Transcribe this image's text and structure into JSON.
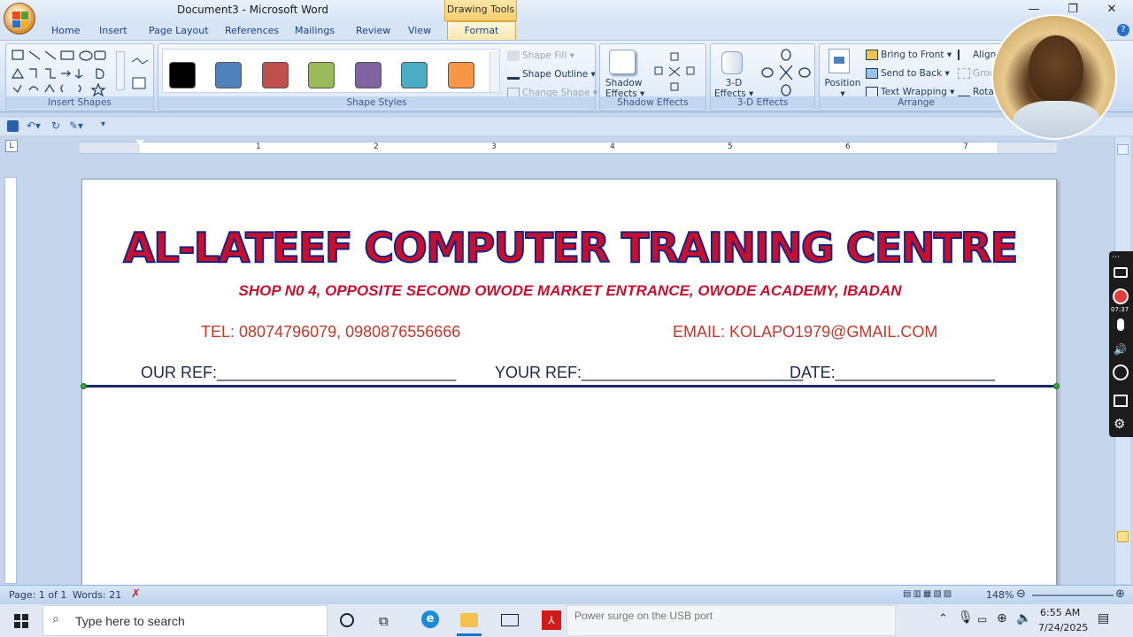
{
  "window": {
    "title": "Document3 - Microsoft Word",
    "contextual_tab_group": "Drawing Tools",
    "controls": {
      "minimize": "—",
      "restore": "❐",
      "close": "✕"
    }
  },
  "ribbon_tabs": [
    "Home",
    "Insert",
    "Page Layout",
    "References",
    "Mailings",
    "Review",
    "View"
  ],
  "active_tab": "Format",
  "groups": {
    "insert_shapes": "Insert Shapes",
    "shape_styles": "Shape Styles",
    "shadow_effects": "Shadow Effects",
    "three_d_effects": "3-D Effects",
    "arrange": "Arrange"
  },
  "shape_styles": {
    "swatches": [
      "#000000",
      "#4f81bd",
      "#c0504d",
      "#9bbb59",
      "#8064a2",
      "#4bacc6",
      "#f79646"
    ],
    "shape_fill": "Shape Fill",
    "shape_outline": "Shape Outline",
    "change_shape": "Change Shape"
  },
  "shadow": {
    "shadow_effects_label": "Shadow",
    "shadow_effects_label2": "Effects"
  },
  "three_d": {
    "label1": "3-D",
    "label2": "Effects"
  },
  "arrange": {
    "position": "Position",
    "bring_to_front": "Bring to Front",
    "send_to_back": "Send to Back",
    "text_wrapping": "Text Wrapping",
    "align": "Align",
    "group": "Grou",
    "rotate": "Rota"
  },
  "ruler_numbers": [
    "1",
    "2",
    "3",
    "4",
    "5",
    "6",
    "7"
  ],
  "document": {
    "headline": "AL-LATEEF COMPUTER TRAINING CENTRE",
    "address": "SHOP N0 4, OPPOSITE SECOND OWODE MARKET ENTRANCE, OWODE ACADEMY, IBADAN",
    "tel": "TEL: 08074796079, 0980876556666",
    "email": "EMAIL: KOLAPO1979@GMAIL.COM",
    "our_ref": "OUR REF:___________________________",
    "your_ref": "YOUR REF:_________________________",
    "date": "DATE:__________________"
  },
  "status_bar": {
    "page": "Page: 1 of 1",
    "words": "Words: 21",
    "zoom": "148%"
  },
  "taskbar": {
    "search_placeholder": "Type here to search",
    "notification": "Power surge on the USB port",
    "time": "6:55 AM",
    "date": "7/24/2025"
  },
  "recorder": {
    "timer": "07:37"
  }
}
